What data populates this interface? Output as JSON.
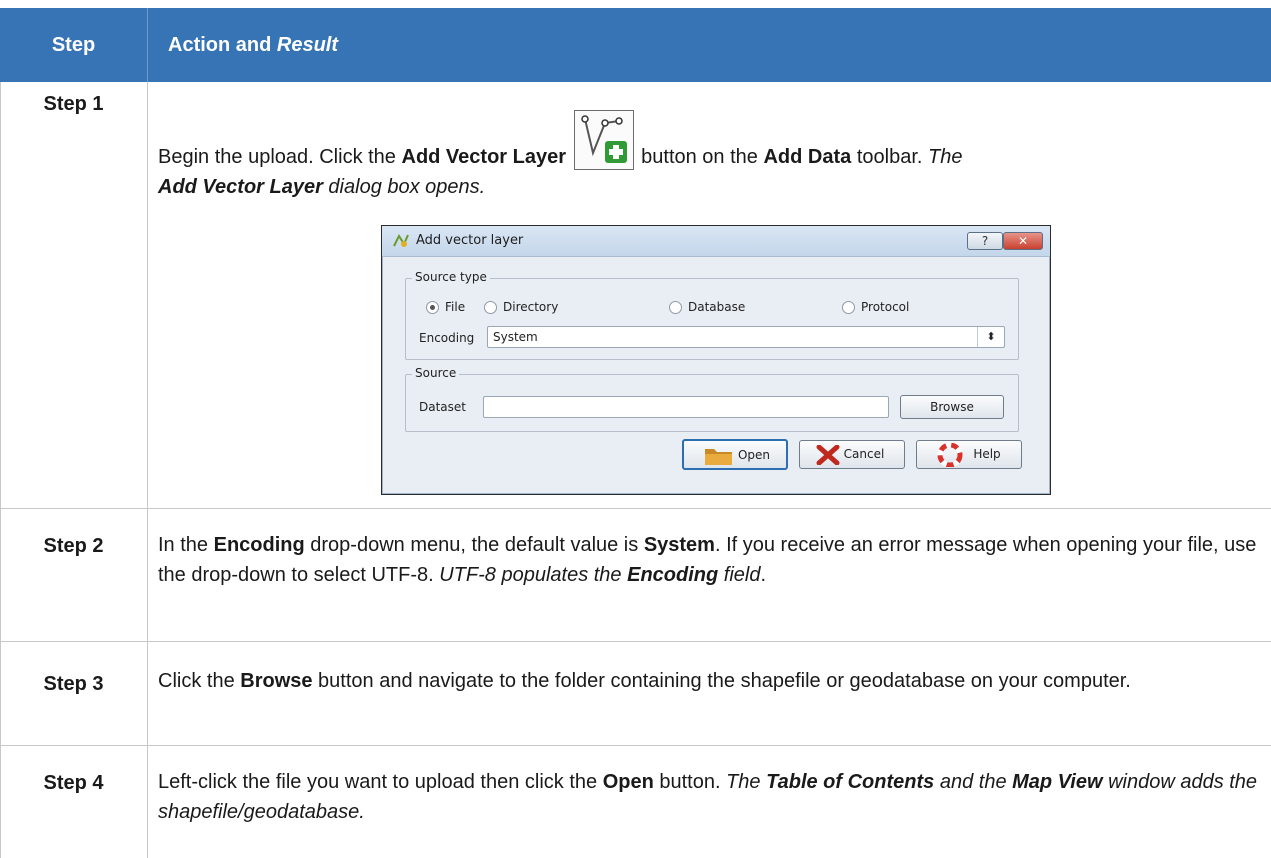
{
  "header": {
    "step_col": "Step",
    "action_col_prefix": "Action and ",
    "action_col_italic": "Result"
  },
  "rows": [
    {
      "step": "Step 1",
      "text": {
        "a": "Begin the upload. Click the ",
        "b": "Add Vector Layer",
        "c": " button on the ",
        "d": "Add Data",
        "e": " toolbar. ",
        "f": "The",
        "g": "Add Vector Layer",
        "h": " dialog box opens."
      }
    },
    {
      "step": "Step 2",
      "text": {
        "a": "In the ",
        "b": "Encoding",
        "c": " drop-down menu, the default value is ",
        "d": "System",
        "e": ". If you receive an error message when opening your file, use the drop-down to select UTF-8. ",
        "f": "UTF-8 populates the ",
        "g": "Encoding",
        "h": " field",
        "i": "."
      }
    },
    {
      "step": "Step 3",
      "text": {
        "a": "Click the ",
        "b": "Browse",
        "c": " button and navigate to the folder containing the shapefile or geodatabase on your computer."
      }
    },
    {
      "step": "Step 4",
      "text": {
        "a": "Left-click the file you want to upload then click the ",
        "b": "Open",
        "c": " button. ",
        "d": "The ",
        "e": "Table of Contents",
        "f": " and the ",
        "g": "Map View",
        "h": " window adds the shapefile/geodatabase."
      }
    }
  ],
  "dialog": {
    "title": "Add vector layer",
    "help_btn": "?",
    "close_btn": "✕",
    "source_type_legend": "Source type",
    "radios": [
      {
        "label": "File",
        "selected": true
      },
      {
        "label": "Directory",
        "selected": false
      },
      {
        "label": "Database",
        "selected": false
      },
      {
        "label": "Protocol",
        "selected": false
      }
    ],
    "encoding_label": "Encoding",
    "encoding_value": "System",
    "source_legend": "Source",
    "dataset_label": "Dataset",
    "dataset_value": "",
    "browse_label": "Browse",
    "open_label": "Open",
    "cancel_label": "Cancel",
    "help_label": "Help"
  },
  "colors": {
    "header_bg": "#3674b6",
    "header_text": "#ffffff",
    "grid_line": "#c8c8c8"
  },
  "icons": [
    "add-vector-layer-icon",
    "qgis-window-icon",
    "folder-icon",
    "cancel-x-icon",
    "help-lifebuoy-icon",
    "combo-arrows-icon"
  ]
}
